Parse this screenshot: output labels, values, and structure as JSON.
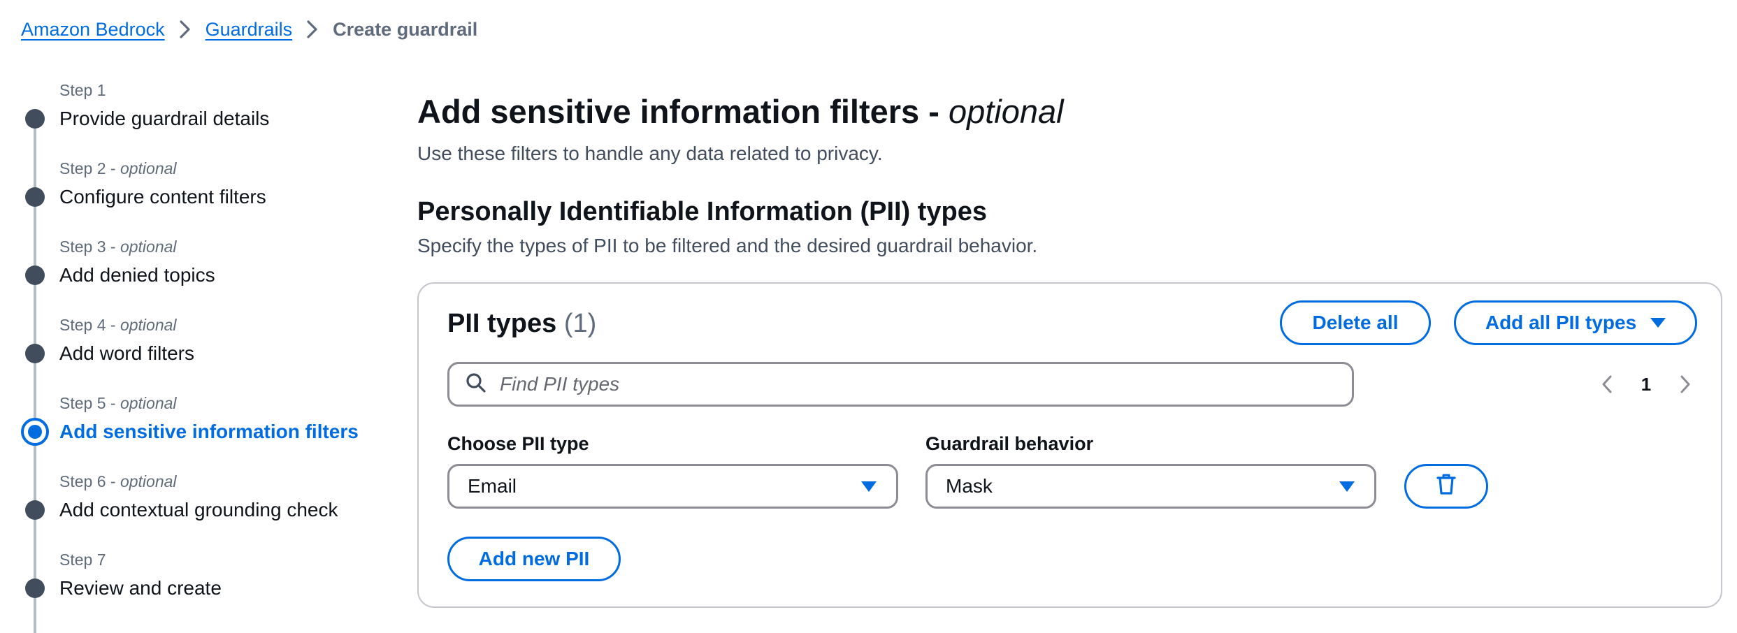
{
  "breadcrumb": {
    "items": [
      "Amazon Bedrock",
      "Guardrails"
    ],
    "current": "Create guardrail"
  },
  "steps": [
    {
      "number": "Step 1",
      "optional": "",
      "label": "Provide guardrail details"
    },
    {
      "number": "Step 2",
      "optional": "optional",
      "label": "Configure content filters"
    },
    {
      "number": "Step 3",
      "optional": "optional",
      "label": "Add denied topics"
    },
    {
      "number": "Step 4",
      "optional": "optional",
      "label": "Add word filters"
    },
    {
      "number": "Step 5",
      "optional": "optional",
      "label": "Add sensitive information filters",
      "active": true
    },
    {
      "number": "Step 6",
      "optional": "optional",
      "label": "Add contextual grounding check"
    },
    {
      "number": "Step 7",
      "optional": "",
      "label": "Review and create"
    }
  ],
  "page": {
    "title": "Add sensitive information filters - ",
    "title_optional": "optional",
    "description": "Use these filters to handle any data related to privacy."
  },
  "pii_section": {
    "title": "Personally Identifiable Information (PII) types",
    "description": "Specify the types of PII to be filtered and the desired guardrail behavior."
  },
  "pii_container": {
    "title": "PII types",
    "count": "(1)",
    "delete_all_label": "Delete all",
    "add_all_label": "Add all PII types",
    "search_placeholder": "Find PII types",
    "page_number": "1",
    "type_label": "Choose PII type",
    "type_value": "Email",
    "behavior_label": "Guardrail behavior",
    "behavior_value": "Mask",
    "add_new_label": "Add new PII"
  },
  "colors": {
    "accent": "#006ce0",
    "text": "#0f141a",
    "muted": "#5f6b7a",
    "step_dot": "#414d5c",
    "border": "#8c8c94"
  },
  "icons": [
    "chevron-right-icon",
    "search-icon",
    "chevron-left-icon",
    "caret-down-icon",
    "trash-icon"
  ]
}
